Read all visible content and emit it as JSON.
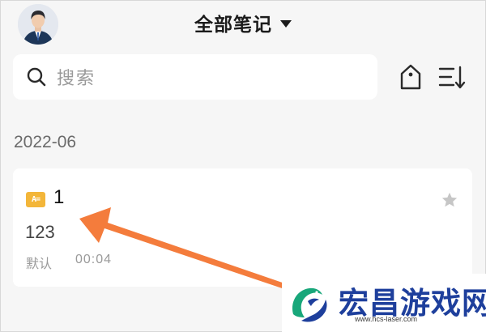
{
  "header": {
    "title": "全部笔记",
    "dropdown_icon": "caret-down-icon",
    "avatar_icon": "user-avatar"
  },
  "search": {
    "placeholder": "搜索",
    "icon": "search-icon"
  },
  "toolbar": {
    "tag_icon": "tag-icon",
    "sort_icon": "sort-icon"
  },
  "groups": [
    {
      "month": "2022-06",
      "notes": [
        {
          "type_badge": "A=",
          "title": "1",
          "body": "123",
          "folder": "默认",
          "time": "00:04",
          "starred": false
        }
      ]
    }
  ],
  "overlay": {
    "arrow_color": "#f47c3c",
    "watermark_brand": "宏昌游戏网",
    "watermark_url": "www.hcs-laser.com",
    "brand_color": "#1e3f9c"
  }
}
